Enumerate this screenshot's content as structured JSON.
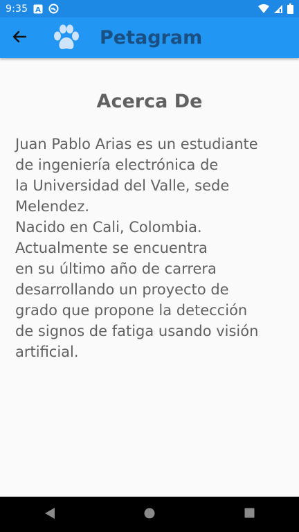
{
  "status_bar": {
    "time": "9:35",
    "icons": [
      "a-icon",
      "sync-icon",
      "wifi-icon",
      "signal-icon",
      "battery-icon"
    ]
  },
  "app_bar": {
    "title": "Petagram",
    "back_icon": "arrow-back-icon",
    "logo_icon": "paw-icon"
  },
  "about": {
    "heading": "Acerca De",
    "body": "Juan Pablo Arias es un estudiante\nde ingeniería electrónica de\nla Universidad del Valle, sede\nMelendez.\nNacido en Cali, Colombia.\nActualmente se encuentra\nen su último año de carrera\ndesarrollando un proyecto de\ngrado que propone la detección\nde signos de fatiga usando visión\nartificial."
  },
  "nav_bar": {
    "buttons": [
      "back-nav-icon",
      "home-nav-icon",
      "recents-nav-icon"
    ]
  },
  "colors": {
    "status_bar": "#1e88e5",
    "app_bar": "#2196f3",
    "title": "#1a4f83",
    "text": "#616161",
    "background": "#fafafa"
  }
}
